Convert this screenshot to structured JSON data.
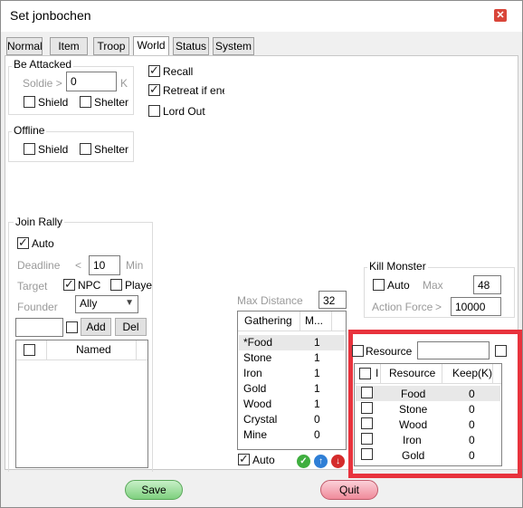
{
  "window": {
    "title": "Set jonbochen"
  },
  "tabs": [
    {
      "label": "Normal"
    },
    {
      "label": "Item"
    },
    {
      "label": "Troop"
    },
    {
      "label": "World"
    },
    {
      "label": "Status"
    },
    {
      "label": "System"
    }
  ],
  "be_attacked": {
    "label": "Be Attacked",
    "soldier_label": "Soldie >",
    "soldier_value": "0",
    "soldier_unit": "K",
    "shield": "Shield",
    "shelter": "Shelter"
  },
  "recall": {
    "recall": "Recall",
    "retreat": "Retreat if ene",
    "lord_out": "Lord Out"
  },
  "offline": {
    "label": "Offline",
    "shield": "Shield",
    "shelter": "Shelter"
  },
  "join_rally": {
    "label": "Join Rally",
    "auto": "Auto",
    "deadline_label": "Deadline",
    "deadline_op": "<",
    "deadline_value": "10",
    "deadline_unit": "Min",
    "target_label": "Target",
    "npc": "NPC",
    "player": "Playe",
    "founder_label": "Founder",
    "founder_value": "Ally",
    "add": "Add",
    "del": "Del",
    "list_header": "Named"
  },
  "gathering": {
    "max_distance_label": "Max Distance",
    "max_distance_value": "32",
    "col_gathering": "Gathering",
    "col_m": "M...",
    "rows": [
      {
        "name": "*Food",
        "value": "1"
      },
      {
        "name": "Stone",
        "value": "1"
      },
      {
        "name": "Iron",
        "value": "1"
      },
      {
        "name": "Gold",
        "value": "1"
      },
      {
        "name": "Wood",
        "value": "1"
      },
      {
        "name": "Crystal",
        "value": "0"
      },
      {
        "name": "Mine",
        "value": "0"
      }
    ],
    "auto": "Auto"
  },
  "kill_monster": {
    "label": "Kill Monster",
    "auto": "Auto",
    "max_label": "Max",
    "max_value": "48",
    "action_force_label": "Action Force",
    "action_force_op": ">",
    "action_force_value": "10000"
  },
  "resource": {
    "label": "Resource",
    "col_i": "I",
    "col_resource": "Resource",
    "col_keep": "Keep(K)",
    "rows": [
      {
        "name": "Food",
        "keep": "0"
      },
      {
        "name": "Stone",
        "keep": "0"
      },
      {
        "name": "Wood",
        "keep": "0"
      },
      {
        "name": "Iron",
        "keep": "0"
      },
      {
        "name": "Gold",
        "keep": "0"
      }
    ]
  },
  "footer": {
    "save": "Save",
    "quit": "Quit"
  },
  "colors": {
    "highlight_frame": "#e8333d",
    "save_green": "#7ed07e",
    "quit_pink": "#f08a9a"
  }
}
